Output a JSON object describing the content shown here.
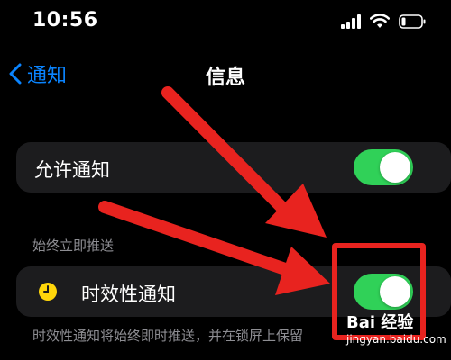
{
  "status_bar": {
    "time": "10:56",
    "icons": [
      "cellular-signal-icon",
      "wifi-icon",
      "battery-icon"
    ]
  },
  "nav": {
    "back_label": "通知",
    "title": "信息"
  },
  "rows": {
    "allow_label": "允许通知",
    "allow_enabled": true,
    "time_sensitive_label": "时效性通知",
    "time_sensitive_enabled": true
  },
  "section_header": "始终立即推送",
  "footer_text": "时效性通知将始终即时推送，并在锁屏上保留",
  "watermark": {
    "brand": "Bai 经验",
    "url": "jingyan.baidu.com"
  },
  "colors": {
    "accent": "#0a84ff",
    "toggle_on": "#30d158",
    "annotation_red": "#e8231f",
    "clock_icon": "#ffd60a"
  }
}
